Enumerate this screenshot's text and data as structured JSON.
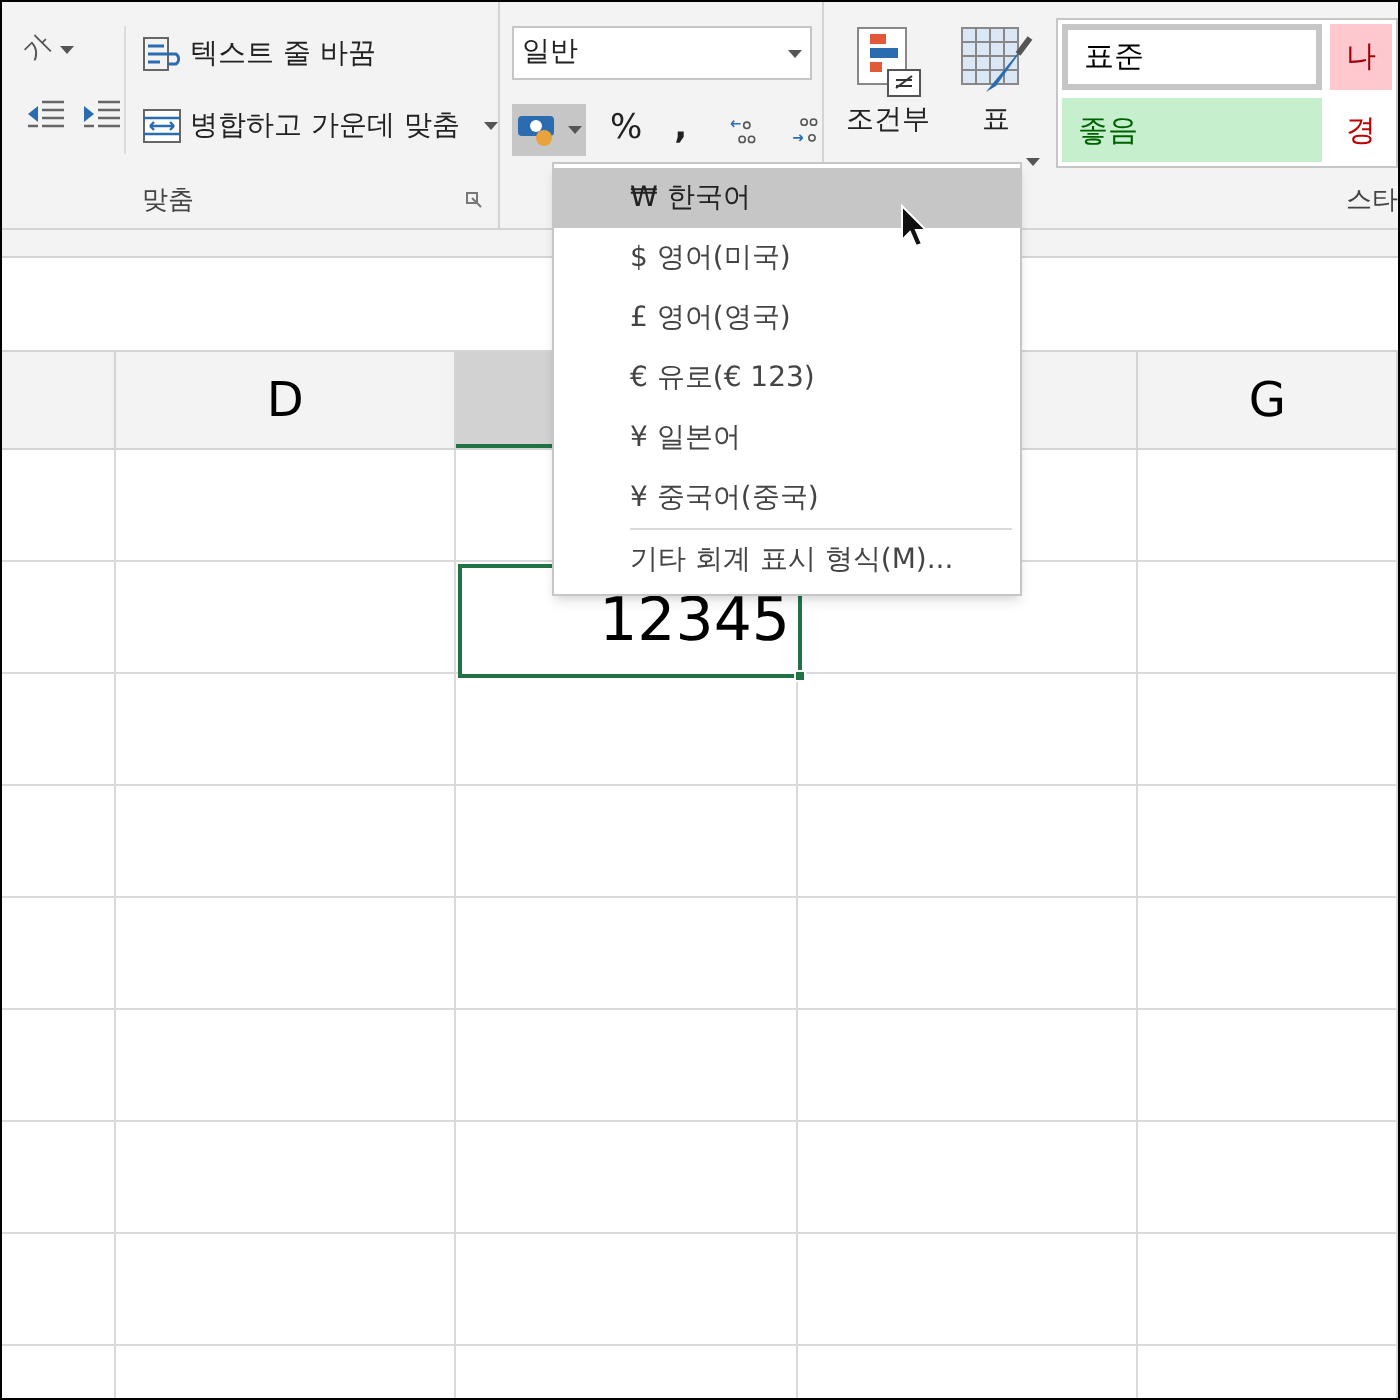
{
  "alignment_group": {
    "orientation": "가",
    "wrap_text": "텍스트 줄 바꿈",
    "merge_center": "병합하고 가운데 맞춤",
    "label": "맞춤"
  },
  "number_group": {
    "format": "일반",
    "accounting_pressed": true,
    "percent": "%",
    "comma": ","
  },
  "table_group": {
    "conditional": [
      "조건부"
    ],
    "format_table": [
      "표"
    ]
  },
  "styles": [
    {
      "label": "표준",
      "kind": "normal"
    },
    {
      "label": "나",
      "kind": "bad"
    },
    {
      "label": "좋음",
      "kind": "good"
    },
    {
      "label": "경",
      "kind": "warning"
    }
  ],
  "styles_label": "스타",
  "menu": [
    {
      "label": "₩ 한국어",
      "selected": true,
      "kind": "currency"
    },
    {
      "label": "$ 영어(미국)",
      "selected": false,
      "kind": "currency"
    },
    {
      "label": "£ 영어(영국)",
      "selected": false,
      "kind": "currency"
    },
    {
      "label": "€ 유로(€ 123)",
      "selected": false,
      "kind": "currency"
    },
    {
      "label": "¥ 일본어",
      "selected": false,
      "kind": "currency"
    },
    {
      "label": "¥ 중국어(중국)",
      "selected": false,
      "kind": "currency"
    },
    {
      "label": "기타 회계 표시 형식(M)...",
      "selected": false,
      "kind": "more"
    }
  ],
  "columns": [
    {
      "selected": false
    },
    {
      "label": "D",
      "selected": false
    },
    {
      "selected": true
    },
    {
      "selected": false
    },
    {
      "label": "G",
      "selected": false
    }
  ],
  "cell": {
    "value": "12345"
  }
}
